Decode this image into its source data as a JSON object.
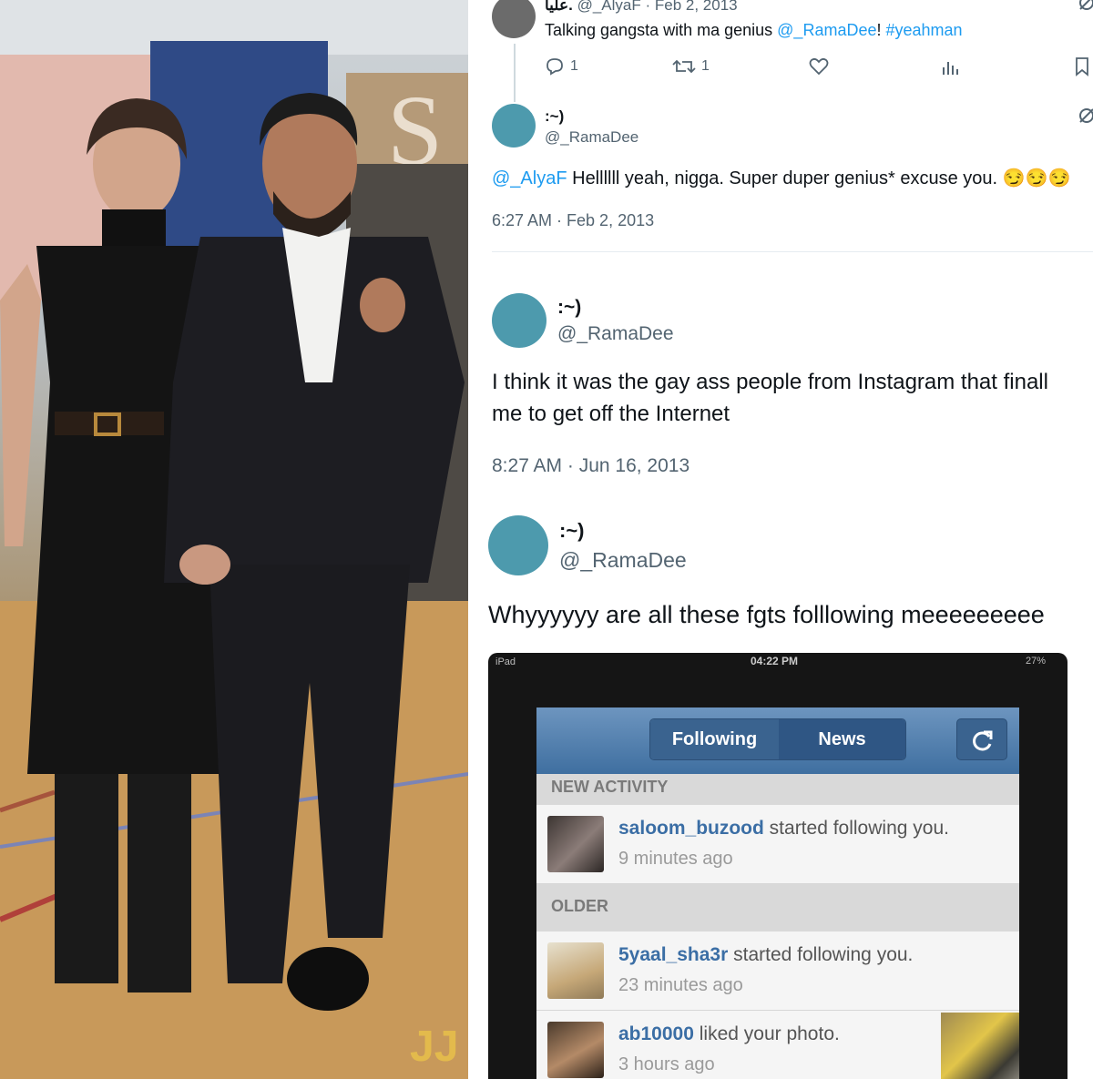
{
  "photo": {
    "watermark": "JJ"
  },
  "tweet_reply_parent": {
    "display_name": "عليا.",
    "handle": "@_AlyaF",
    "date": "Feb 2, 2013",
    "text_before": "Talking gangsta with ma genius ",
    "mention": "@_RamaDee",
    "text_mid": "! ",
    "hashtag": "#yeahman",
    "replies": "1",
    "retweets": "1"
  },
  "tweet1": {
    "display_name": ":~)",
    "handle": "@_RamaDee",
    "mention": "@_AlyaF",
    "text": " Hellllll yeah, nigga. Super duper genius* excuse you.",
    "emoji": "😏😏😏",
    "timestamp": "6:27 AM · Feb 2, 2013"
  },
  "tweet2": {
    "display_name": ":~)",
    "handle": "@_RamaDee",
    "line1": "I think it was the gay ass people from Instagram that finall",
    "line2": "me to get off the Internet",
    "timestamp": "8:27 AM · Jun 16, 2013"
  },
  "tweet3": {
    "display_name": ":~)",
    "handle": "@_RamaDee",
    "text": "Whyyyyyy are all these fgts folllowing meeeeeeeee"
  },
  "ipad": {
    "carrier": "iPad",
    "time": "04:22 PM",
    "battery": "27%",
    "tabs": [
      "Following",
      "News"
    ],
    "section_new": "NEW ACTIVITY",
    "section_older": "OLDER",
    "items": [
      {
        "user": "saloom_buzood",
        "action": " started following you.",
        "time": "9 minutes ago"
      },
      {
        "user": "5yaal_sha3r",
        "action": " started following you.",
        "time": "23 minutes ago"
      },
      {
        "user": "ab10000",
        "action": " liked your photo.",
        "time": "3 hours ago"
      }
    ]
  },
  "colors": {
    "link": "#1d9bf0",
    "avatar": "#4d9aad",
    "muted": "#536471",
    "ig_header": "#3f6fa0"
  },
  "icons": [
    "reply-icon",
    "retweet-icon",
    "like-icon",
    "views-icon",
    "bookmark-icon",
    "grok-icon",
    "refresh-icon"
  ]
}
